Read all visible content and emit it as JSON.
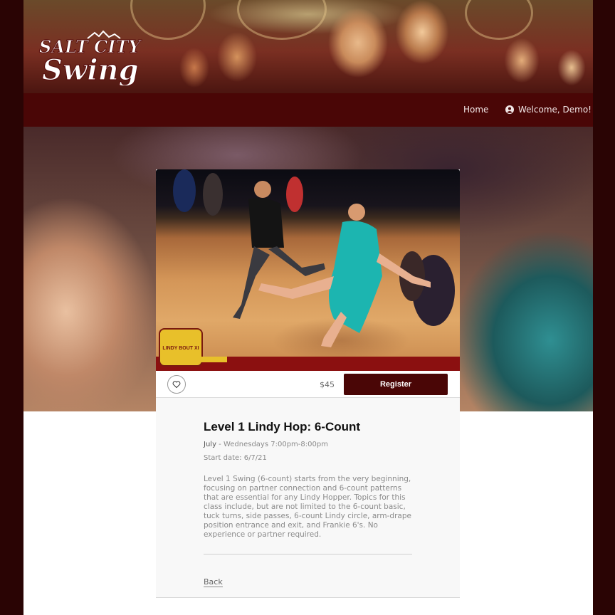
{
  "header": {
    "logo_text_line1": "SALT CITY",
    "logo_text_line2": "Swing"
  },
  "nav": {
    "home_label": "Home",
    "welcome_label": "Welcome, Demo!",
    "user_icon": "user-circle-icon"
  },
  "colors": {
    "brand_dark": "#4a0606",
    "outer_background": "#2a0404"
  },
  "event": {
    "photo_badge_text": "LINDY BOUT XI",
    "favorite_icon": "heart-icon",
    "price": "$45",
    "register_label": "Register",
    "title": "Level 1 Lindy Hop: 6-Count",
    "schedule_month": "July",
    "schedule_sep": " - ",
    "schedule_time": "Wednesdays 7:00pm-8:00pm",
    "start_date": "Start date: 6/7/21",
    "description": "Level 1 Swing (6-count) starts from the very beginning, focusing on partner connection and 6-count patterns that are essential for any Lindy Hopper. Topics for this class include, but are not limited to the 6-count basic, tuck turns, side passes, 6-count Lindy circle, arm-drape position entrance and exit, and Frankie 6's. No experience or partner required.",
    "back_label": "Back"
  }
}
